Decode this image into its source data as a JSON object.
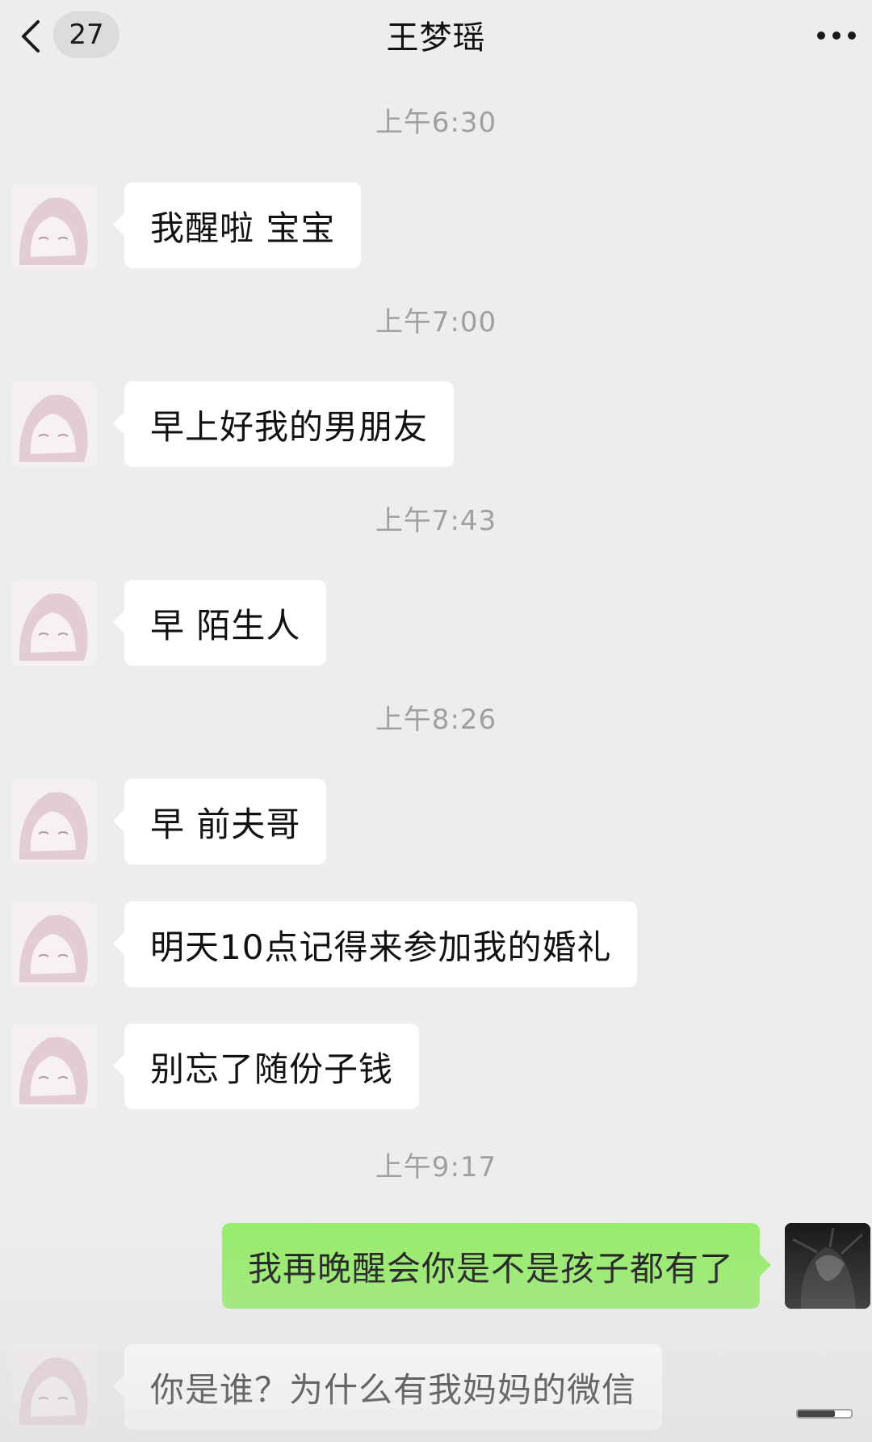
{
  "header": {
    "unread_count": "27",
    "title": "王梦瑶"
  },
  "messages": [
    {
      "time": "上午6:30"
    },
    {
      "text": "我醒啦 宝宝"
    },
    {
      "time": "上午7:00"
    },
    {
      "text": "早上好我的男朋友"
    },
    {
      "time": "上午7:43"
    },
    {
      "text": "早 陌生人"
    },
    {
      "time": "上午8:26"
    },
    {
      "text": "早 前夫哥"
    },
    {
      "text": "明天10点记得来参加我的婚礼"
    },
    {
      "text": "别忘了随份子钱"
    },
    {
      "time": "上午9:17"
    },
    {
      "text": "我再晚醒会你是不是孩子都有了"
    },
    {
      "text": "你是谁？为什么有我妈妈的微信"
    }
  ],
  "colors": {
    "background": "#ededed",
    "incoming_bubble": "#ffffff",
    "outgoing_bubble": "#95ec69"
  }
}
